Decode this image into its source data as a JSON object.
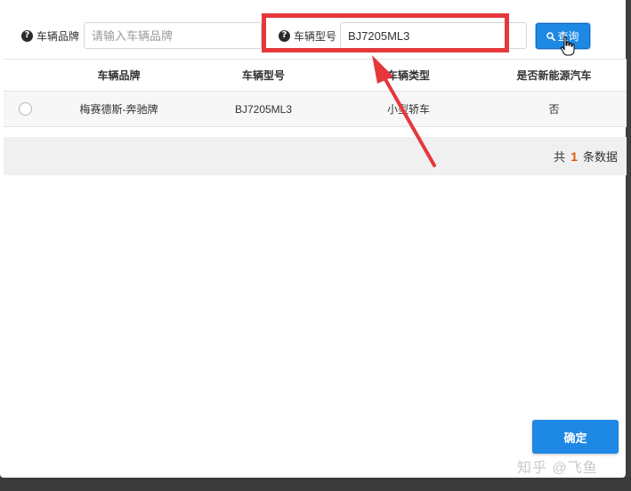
{
  "search": {
    "brand_label": "车辆品牌",
    "brand_placeholder": "请输入车辆品牌",
    "brand_value": "",
    "model_label": "车辆型号",
    "model_value": "BJ7205ML3",
    "query_button": "查询"
  },
  "table": {
    "headers": [
      "车辆品牌",
      "车辆型号",
      "车辆类型",
      "是否新能源汽车"
    ],
    "rows": [
      {
        "brand": "梅赛德斯-奔驰牌",
        "model": "BJ7205ML3",
        "type": "小型轿车",
        "nev": "否"
      }
    ]
  },
  "pagination": {
    "prefix": "共",
    "total": "1",
    "suffix": "条数据"
  },
  "confirm_button": "确定",
  "watermark": "知乎 @飞鱼",
  "colors": {
    "accent": "#1e88e5",
    "highlight": "#e5373c",
    "count": "#e05a00"
  }
}
